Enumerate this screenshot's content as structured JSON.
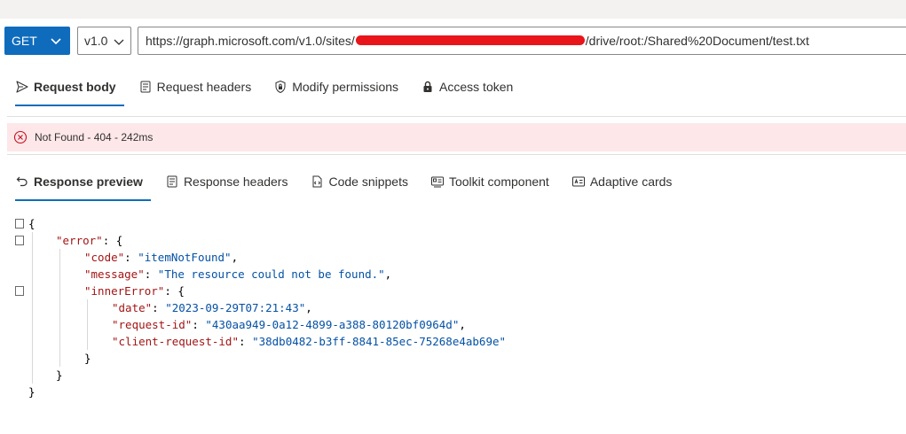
{
  "request": {
    "method": "GET",
    "version": "v1.0",
    "url_prefix": "https://graph.microsoft.com/v1.0/sites/",
    "url_suffix": "/drive/root:/Shared%20Document/test.txt"
  },
  "request_tabs": [
    {
      "label": "Request body",
      "icon": "send-icon"
    },
    {
      "label": "Request headers",
      "icon": "headers-icon"
    },
    {
      "label": "Modify permissions",
      "icon": "shield-lock-icon"
    },
    {
      "label": "Access token",
      "icon": "lock-icon"
    }
  ],
  "status": {
    "text": "Not Found - 404 - 242ms",
    "color": "#fde7e9"
  },
  "response_tabs": [
    {
      "label": "Response preview",
      "icon": "undo-arrow-icon"
    },
    {
      "label": "Response headers",
      "icon": "headers-icon"
    },
    {
      "label": "Code snippets",
      "icon": "code-snippet-icon"
    },
    {
      "label": "Toolkit component",
      "icon": "toolkit-icon"
    },
    {
      "label": "Adaptive cards",
      "icon": "adaptive-card-icon"
    }
  ],
  "response_json": {
    "open_brace": "{",
    "error_key": "\"error\"",
    "code_key": "\"code\"",
    "code_val": "\"itemNotFound\"",
    "message_key": "\"message\"",
    "message_val": "\"The resource could not be found.\"",
    "inner_key": "\"innerError\"",
    "date_key": "\"date\"",
    "date_val": "\"2023-09-29T07:21:43\"",
    "reqid_key": "\"request-id\"",
    "reqid_val": "\"430aa949-0a12-4899-a388-80120bf0964d\"",
    "creqid_key": "\"client-request-id\"",
    "creqid_val": "\"38db0482-b3ff-8841-85ec-75268e4ab69e\"",
    "close_brace": "}"
  },
  "colors": {
    "accent": "#0f6cbd",
    "error_bg": "#fde7e9",
    "json_key": "#a31515",
    "json_string": "#0451a5"
  }
}
